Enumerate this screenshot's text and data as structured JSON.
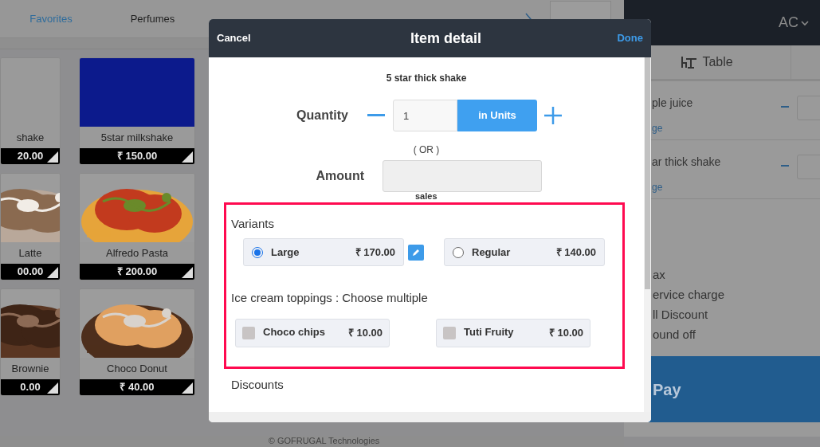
{
  "category_tabs": [
    {
      "label": "Favorites",
      "selected": true
    },
    {
      "label": "Perfumes",
      "selected": false
    }
  ],
  "menu_items": [
    {
      "name": "shake",
      "price": "20.00",
      "kind": "blank"
    },
    {
      "name": "5star milkshake",
      "price": "₹ 150.00",
      "kind": "swatch"
    },
    {
      "name": "Latte",
      "price": "00.00",
      "kind": "picture"
    },
    {
      "name": "Alfredo Pasta",
      "price": "₹ 200.00",
      "kind": "picture"
    },
    {
      "name": "Brownie",
      "price": "0.00",
      "kind": "picture"
    },
    {
      "name": "Choco Donut",
      "price": "₹ 40.00",
      "kind": "picture"
    }
  ],
  "footer": "© GOFRUGAL Technologies",
  "order_panel": {
    "user": "AC",
    "tab": "Table",
    "lines": [
      {
        "name": "ple juice",
        "link": "ge"
      },
      {
        "name": "ar thick shake",
        "link": "ge"
      }
    ],
    "summary": [
      "ax",
      "ervice charge",
      "ll Discount",
      "ound off"
    ],
    "pay": "Pay"
  },
  "item_detail": {
    "cancel": "Cancel",
    "title": "Item detail",
    "done": "Done",
    "item_name": "5 star thick shake",
    "quantity_label": "Quantity",
    "quantity": "1",
    "unit_button": "in Units",
    "or_text": "( OR )",
    "amount_label": "Amount",
    "amount_note": "sales",
    "variants_title": "Variants",
    "variants": [
      {
        "name": "Large",
        "price": "₹ 170.00",
        "selected": true
      },
      {
        "name": "Regular",
        "price": "₹ 140.00",
        "selected": false
      }
    ],
    "toppings_title": "Ice cream toppings : Choose multiple",
    "toppings": [
      {
        "name": "Choco chips",
        "price": "₹ 10.00",
        "checked": false
      },
      {
        "name": "Tuti Fruity",
        "price": "₹ 10.00",
        "checked": false
      }
    ],
    "discounts_title": "Discounts"
  }
}
